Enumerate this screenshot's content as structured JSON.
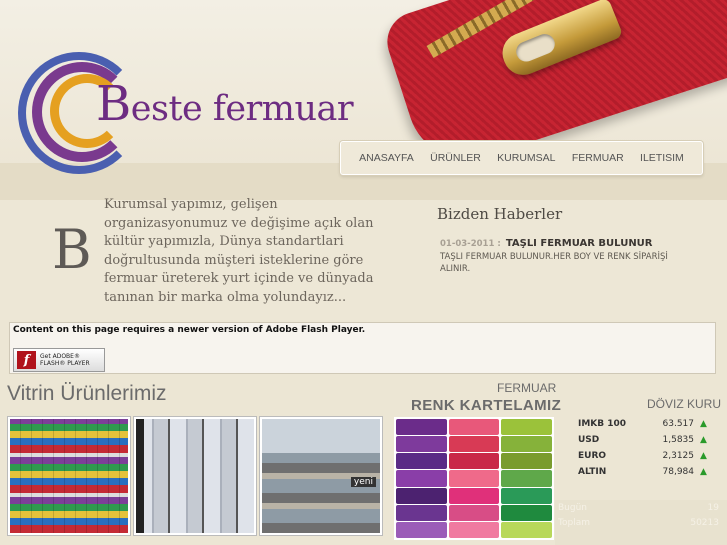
{
  "logo": {
    "big_letter": "B",
    "rest": "este fermuar"
  },
  "nav": [
    "ANASAYFA",
    "ÜRÜNLER",
    "KURUMSAL",
    "FERMUAR",
    "ILETISIM"
  ],
  "intro": {
    "dropcap": "B",
    "lines": [
      "Kurumsal yapımız, gelişen",
      "organizasyonumuz ve değişime açık olan",
      "kültür yapımızla, Dünya standartlari",
      "doğrultusunda müşteri isteklerine göre",
      "fermuar üreterek yurt içinde ve dünyada",
      "tanınan bir marka olma yolundayız..."
    ]
  },
  "news": {
    "title": "Bizden Haberler",
    "date": "01-03-2011 :",
    "headline": "TAŞLI FERMUAR BULUNUR",
    "body": "TAŞLI FERMUAR BULUNUR.HER BOY VE RENK SİPARİŞİ ALINIR."
  },
  "flash": {
    "message": "Content on this page requires a newer version of Adobe Flash Player.",
    "button_line1": "Get ADOBE®",
    "button_line2": "FLASH® PLAYER",
    "button_icon": "f"
  },
  "vitrin": {
    "title": "Vitrin Ürünlerimiz",
    "thumb3_label": "yeni"
  },
  "kartela": {
    "small": "FERMUAR",
    "big": "RENK KARTELAMIZ",
    "colors": [
      [
        "#6b2c8a",
        "#7e3a9c",
        "#5a2b86",
        "#8a3ea8",
        "#4c2270",
        "#6a3590",
        "#9b5cb8"
      ],
      [
        "#e8587a",
        "#d83a55",
        "#c92848",
        "#ef6a8a",
        "#e0307a",
        "#d84d86",
        "#f07aa0"
      ],
      [
        "#9bc23a",
        "#86b23a",
        "#7a9c2e",
        "#5fa84a",
        "#2a9a58",
        "#1f8a3e",
        "#b8d85a"
      ]
    ]
  },
  "doviz": {
    "title": "DÖVIZ KURU",
    "rows": [
      {
        "name": "IMKB 100",
        "value": "63.517"
      },
      {
        "name": "USD",
        "value": "1,5835"
      },
      {
        "name": "EURO",
        "value": "2,3125"
      },
      {
        "name": "ALTIN",
        "value": "78,984"
      }
    ],
    "arrow": "▲",
    "up_color": "#2a9a2a"
  },
  "stats": [
    {
      "label": "Bugün",
      "value": "19"
    },
    {
      "label": "Toplam",
      "value": "50213"
    }
  ]
}
